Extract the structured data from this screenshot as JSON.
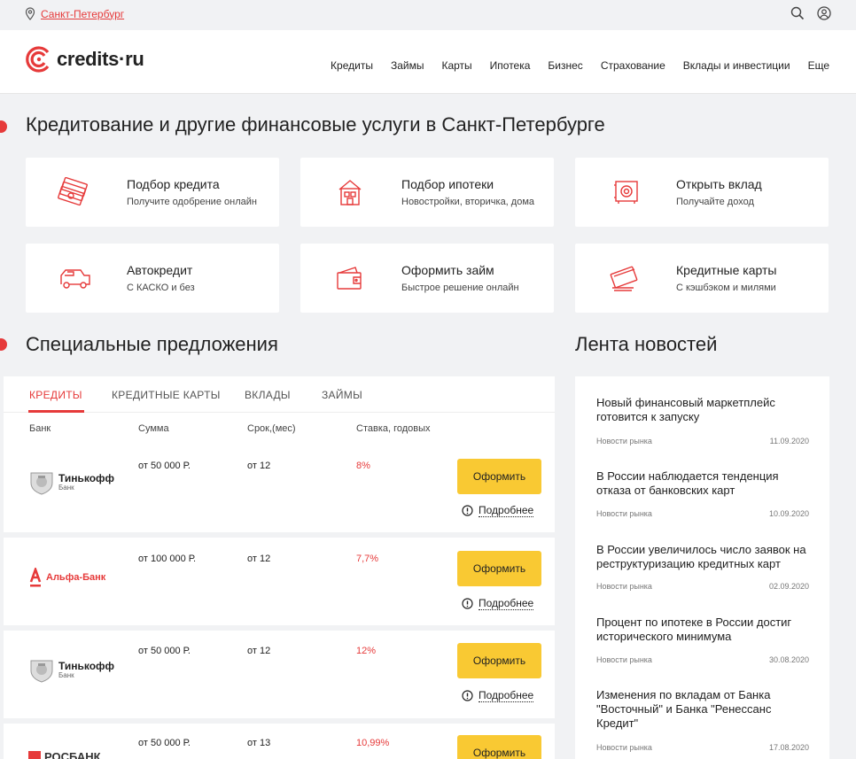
{
  "topbar": {
    "city": "Санкт-Петербург"
  },
  "header": {
    "logo": "credits·ru",
    "nav": [
      "Кредиты",
      "Займы",
      "Карты",
      "Ипотека",
      "Бизнес",
      "Страхование",
      "Вклады и инвестиции",
      "Еще"
    ]
  },
  "main": {
    "title": "Кредитование и другие финансовые услуги в Санкт-Петербурге",
    "tiles": [
      {
        "title": "Подбор кредита",
        "sub": "Получите одобрение онлайн",
        "icon": "money-stack-icon"
      },
      {
        "title": "Подбор ипотеки",
        "sub": "Новостройки, вторичка, дома",
        "icon": "house-icon"
      },
      {
        "title": "Открыть вклад",
        "sub": "Получайте доход",
        "icon": "safe-icon"
      },
      {
        "title": "Автокредит",
        "sub": "С КАСКО и без",
        "icon": "car-icon"
      },
      {
        "title": "Оформить займ",
        "sub": "Быстрое решение онлайн",
        "icon": "wallet-icon"
      },
      {
        "title": "Кредитные карты",
        "sub": "С кэшбэком и милями",
        "icon": "card-icon"
      }
    ]
  },
  "offers": {
    "title": "Специальные предложения",
    "tabs": [
      "КРЕДИТЫ",
      "КРЕДИТНЫЕ КАРТЫ",
      "ВКЛАДЫ",
      "ЗАЙМЫ"
    ],
    "columns": [
      "Банк",
      "Сумма",
      "Срок,(мес)",
      "Ставка, годовых"
    ],
    "button_label": "Оформить",
    "more_label": "Подробнее",
    "rows": [
      {
        "bank": "Тинькофф",
        "bank_sub": "Банк",
        "sum": "от 50 000 Р.",
        "term": "от 12",
        "rate": "8%"
      },
      {
        "bank": "Альфа-Банк",
        "bank_sub": "",
        "sum": "от 100 000 Р.",
        "term": "от 12",
        "rate": "7,7%"
      },
      {
        "bank": "Тинькофф",
        "bank_sub": "Банк",
        "sum": "от 50 000 Р.",
        "term": "от 12",
        "rate": "12%"
      },
      {
        "bank": "РОСБАНК",
        "bank_sub": "",
        "sum": "от 50 000 Р.",
        "term": "от 13",
        "rate": "10,99%"
      }
    ]
  },
  "news": {
    "title": "Лента новостей",
    "items": [
      {
        "title": "Новый финансовый маркетплейс готовится к запуску",
        "category": "Новости рынка",
        "date": "11.09.2020"
      },
      {
        "title": "В России наблюдается тенденция отказа от банковских карт",
        "category": "Новости рынка",
        "date": "10.09.2020"
      },
      {
        "title": "В России увеличилось число заявок на реструктуризацию кредитных карт",
        "category": "Новости рынка",
        "date": "02.09.2020"
      },
      {
        "title": "Процент по ипотеке в России достиг исторического минимума",
        "category": "Новости рынка",
        "date": "30.08.2020"
      },
      {
        "title": "Изменения по вкладам от Банка \"Восточный\" и Банка \"Ренессанс Кредит\"",
        "category": "Новости рынка",
        "date": "17.08.2020"
      }
    ]
  },
  "colors": {
    "accent": "#e63a3a",
    "button": "#f9c933",
    "background": "#f1f2f4"
  }
}
